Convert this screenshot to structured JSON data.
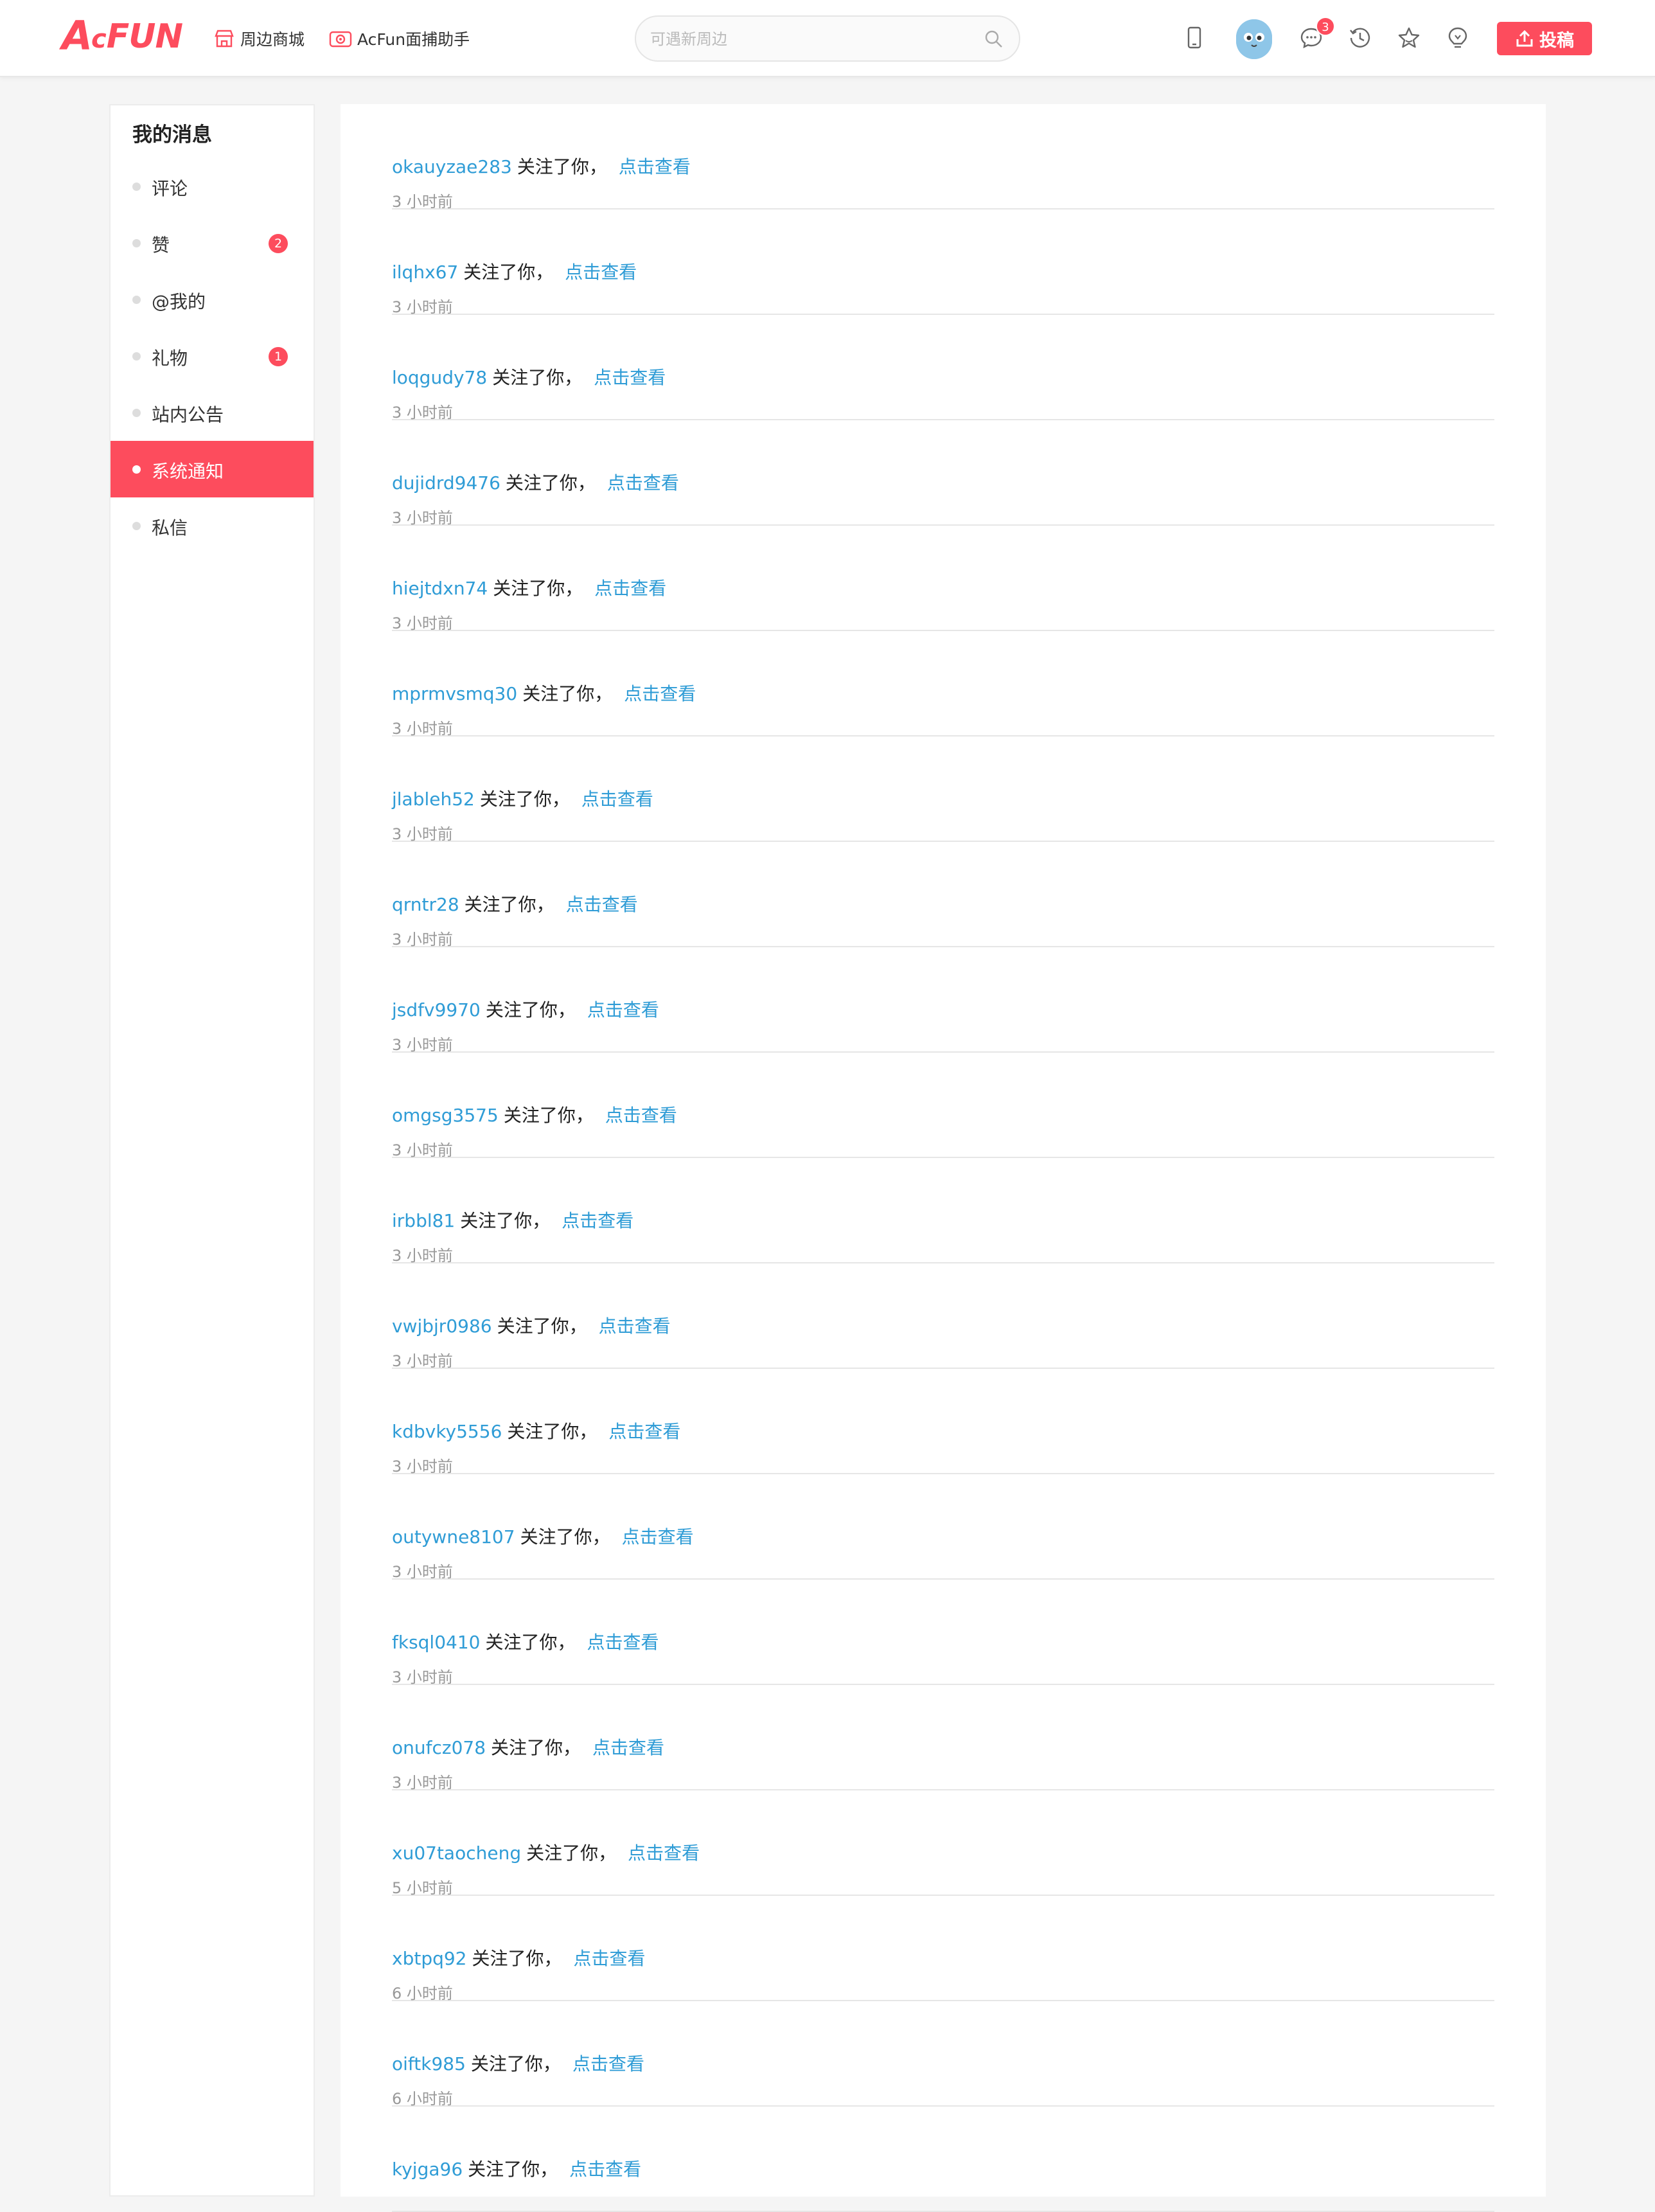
{
  "header": {
    "logo": "AcFun",
    "nav": [
      {
        "label": "周边商城",
        "icon": "store-icon"
      },
      {
        "label": "AcFun面捕助手",
        "icon": "camera-icon"
      }
    ],
    "search_placeholder": "可遇新周边",
    "message_badge": "3",
    "upload_label": "投稿"
  },
  "sidebar": {
    "title": "我的消息",
    "items": [
      {
        "label": "评论",
        "badge": ""
      },
      {
        "label": "赞",
        "badge": "2"
      },
      {
        "label": "@我的",
        "badge": ""
      },
      {
        "label": "礼物",
        "badge": "1"
      },
      {
        "label": "站内公告",
        "badge": ""
      },
      {
        "label": "系统通知",
        "badge": "",
        "active": true
      },
      {
        "label": "私信",
        "badge": ""
      }
    ]
  },
  "notices": {
    "action_text": "关注了你，",
    "view_text": "点击查看",
    "items": [
      {
        "user": "okauyzae283",
        "time": "3 小时前"
      },
      {
        "user": "ilqhx67",
        "time": "3 小时前"
      },
      {
        "user": "loqgudy78",
        "time": "3 小时前"
      },
      {
        "user": "dujidrd9476",
        "time": "3 小时前"
      },
      {
        "user": "hiejtdxn74",
        "time": "3 小时前"
      },
      {
        "user": "mprmvsmq30",
        "time": "3 小时前"
      },
      {
        "user": "jlableh52",
        "time": "3 小时前"
      },
      {
        "user": "qrntr28",
        "time": "3 小时前"
      },
      {
        "user": "jsdfv9970",
        "time": "3 小时前"
      },
      {
        "user": "omgsg3575",
        "time": "3 小时前"
      },
      {
        "user": "irbbl81",
        "time": "3 小时前"
      },
      {
        "user": "vwjbjr0986",
        "time": "3 小时前"
      },
      {
        "user": "kdbvky5556",
        "time": "3 小时前"
      },
      {
        "user": "outywne8107",
        "time": "3 小时前"
      },
      {
        "user": "fksql0410",
        "time": "3 小时前"
      },
      {
        "user": "onufcz078",
        "time": "3 小时前"
      },
      {
        "user": "xu07taocheng",
        "time": "5 小时前"
      },
      {
        "user": "xbtpq92",
        "time": "6 小时前"
      },
      {
        "user": "oiftk985",
        "time": "6 小时前"
      },
      {
        "user": "kyjga96",
        "time": ""
      }
    ]
  },
  "colors": {
    "accent": "#fd4c5d",
    "link": "#2f9cd6"
  }
}
